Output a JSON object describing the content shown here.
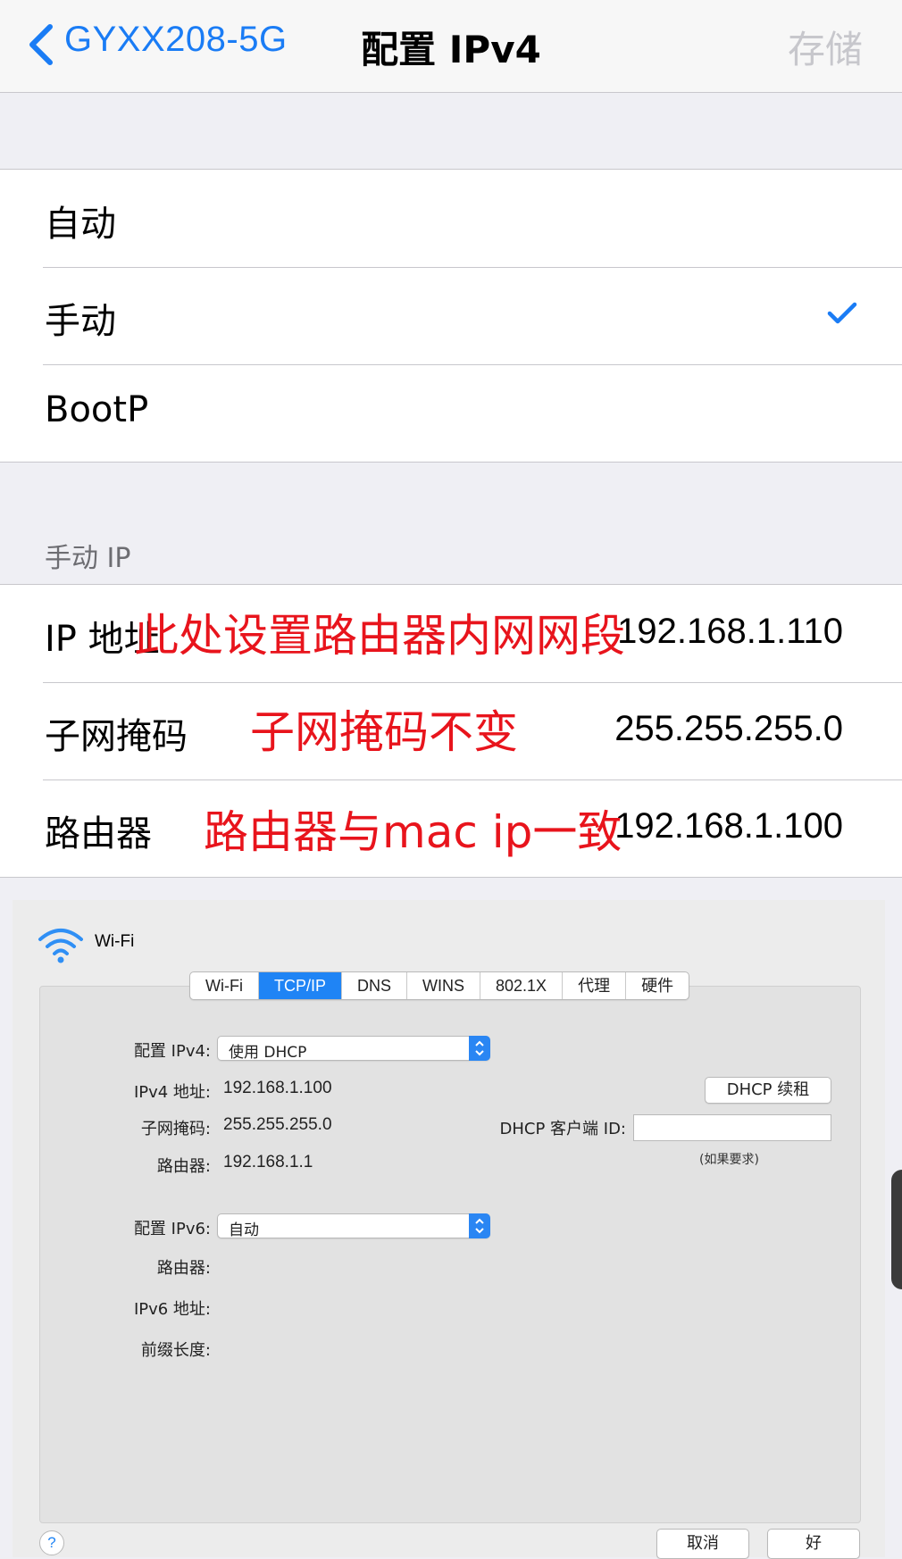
{
  "navbar": {
    "back_label": "GYXX208-5G",
    "title": "配置 IPv4",
    "save_label": "存储"
  },
  "config_options": [
    {
      "label": "自动",
      "selected": false
    },
    {
      "label": "手动",
      "selected": true
    },
    {
      "label": "BootP",
      "selected": false
    }
  ],
  "manual_ip": {
    "header": "手动 IP",
    "rows": [
      {
        "label": "IP 地址",
        "value": "192.168.1.110"
      },
      {
        "label": "子网掩码",
        "value": "255.255.255.0"
      },
      {
        "label": "路由器",
        "value": "192.168.1.100"
      }
    ]
  },
  "annotations": {
    "ip": "此处设置路由器内网网段",
    "subnet": "子网掩码不变",
    "router": "路由器与mac ip一致"
  },
  "mac": {
    "window_title": "Wi-Fi",
    "tabs": [
      "Wi-Fi",
      "TCP/IP",
      "DNS",
      "WINS",
      "802.1X",
      "代理",
      "硬件"
    ],
    "active_tab": "TCP/IP",
    "config_ipv4_label": "配置 IPv4:",
    "config_ipv4_value": "使用 DHCP",
    "ipv4_address_label": "IPv4 地址:",
    "ipv4_address_value": "192.168.1.100",
    "subnet_label": "子网掩码:",
    "subnet_value": "255.255.255.0",
    "router_label": "路由器:",
    "router_value": "192.168.1.1",
    "dhcp_renew_button": "DHCP 续租",
    "dhcp_client_id_label": "DHCP 客户端 ID:",
    "dhcp_client_id_value": "",
    "dhcp_client_id_hint": "(如果要求)",
    "config_ipv6_label": "配置 IPv6:",
    "config_ipv6_value": "自动",
    "router6_label": "路由器:",
    "ipv6_address_label": "IPv6 地址:",
    "prefix_length_label": "前缀长度:",
    "help_label": "?",
    "cancel_button": "取消",
    "ok_button": "好"
  },
  "colors": {
    "ios_blue": "#1a7cf5",
    "annotation_red": "#e8141c",
    "mac_accent": "#1f84f5"
  }
}
